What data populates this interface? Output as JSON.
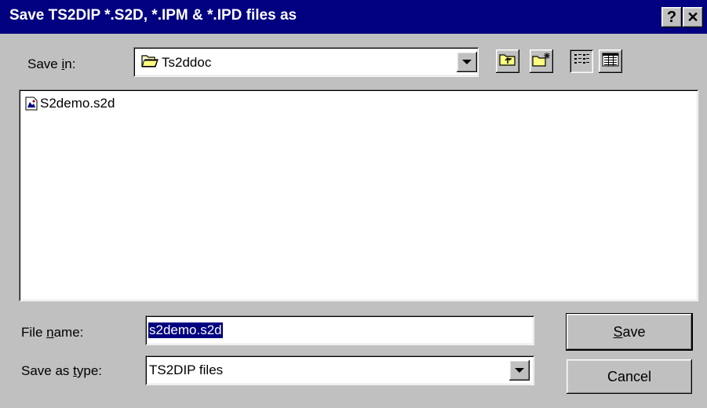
{
  "dialog": {
    "title": "Save TS2DIP *.S2D, *.IPM & *.IPD files as",
    "help_glyph": "?",
    "close_glyph": "✕"
  },
  "save_in": {
    "label_pre": "Save ",
    "label_u": "i",
    "label_post": "n:",
    "value": "Ts2ddoc"
  },
  "files": [
    {
      "name": "S2demo.s2d",
      "icon": "document-icon"
    }
  ],
  "file_name": {
    "label_pre": "File ",
    "label_u": "n",
    "label_post": "ame:",
    "value": "s2demo.s2d"
  },
  "save_as_type": {
    "label_pre": "Save as ",
    "label_u": "t",
    "label_post": "ype:",
    "value": "TS2DIP files"
  },
  "buttons": {
    "save_u": "S",
    "save_rest": "ave",
    "cancel": "Cancel"
  },
  "toolbar": {
    "icons": [
      "up-one-level-icon",
      "create-new-folder-icon",
      "list-view-icon",
      "details-view-icon"
    ]
  },
  "colors": {
    "title_bar": "#000080",
    "face": "#c0c0c0",
    "selection": "#000080"
  }
}
